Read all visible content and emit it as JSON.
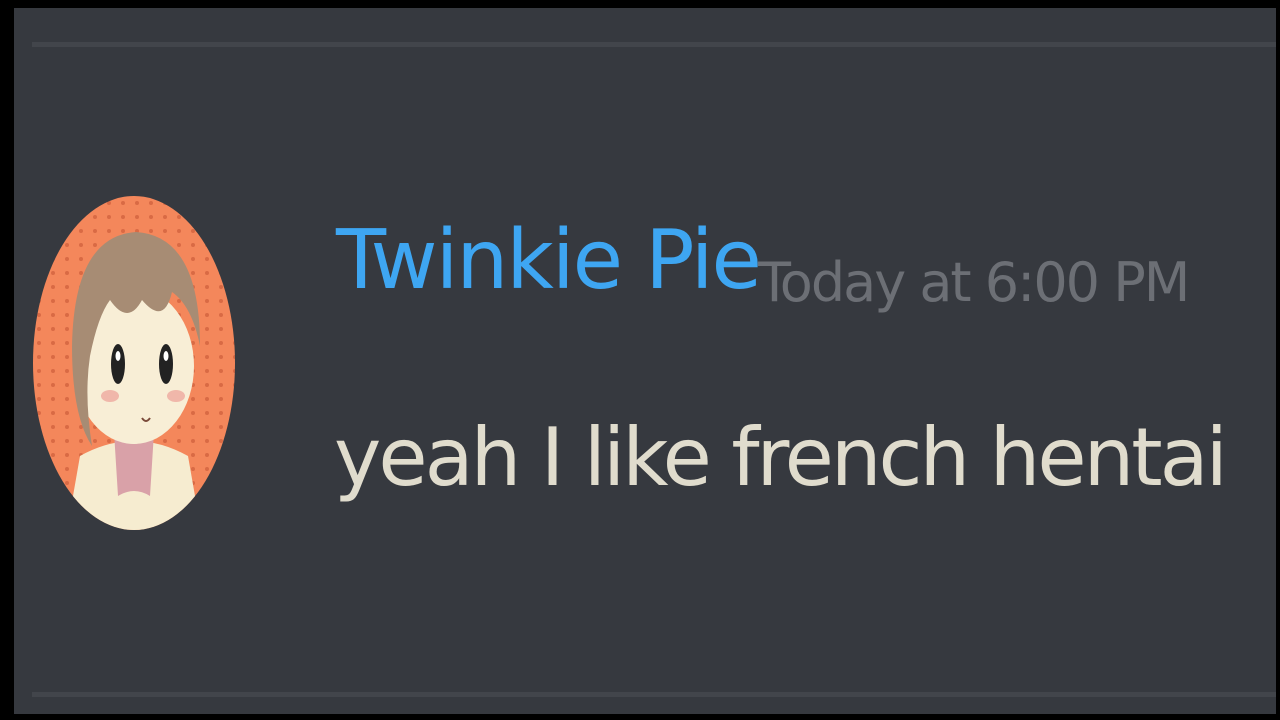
{
  "colors": {
    "background": "#36393f",
    "username": "#3ea6f2",
    "timestamp": "#6c6f75",
    "message_text": "#e0dccd",
    "avatar_ring": "#f4875b"
  },
  "message": {
    "author": {
      "name": "Twinkie Pie",
      "avatar_icon": "user-avatar"
    },
    "timestamp": "Today at 6:00 PM",
    "content": "yeah I like french hentai"
  }
}
